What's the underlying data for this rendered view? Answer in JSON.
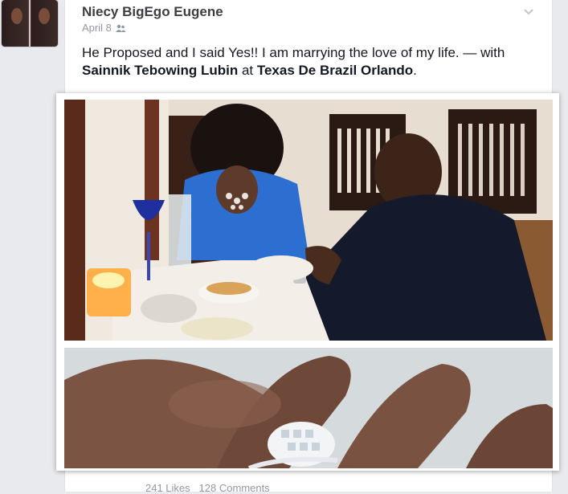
{
  "post": {
    "author": "Niecy BigEgo Eugene",
    "date": "April 8",
    "audience_icon": "friends-icon",
    "text_before": "He Proposed and I said Yes!! I am marrying the love of my life. — with ",
    "tagged_friend": "Sainnik Tebowing Lubin",
    "at_word": " at ",
    "place": "Texas De Brazil Orlando",
    "text_end": "."
  },
  "photos": [
    {
      "icon": "proposal-photo"
    },
    {
      "icon": "ring-photo"
    }
  ],
  "footer": {
    "likes": "241 Likes",
    "comments": "128 Comments"
  }
}
